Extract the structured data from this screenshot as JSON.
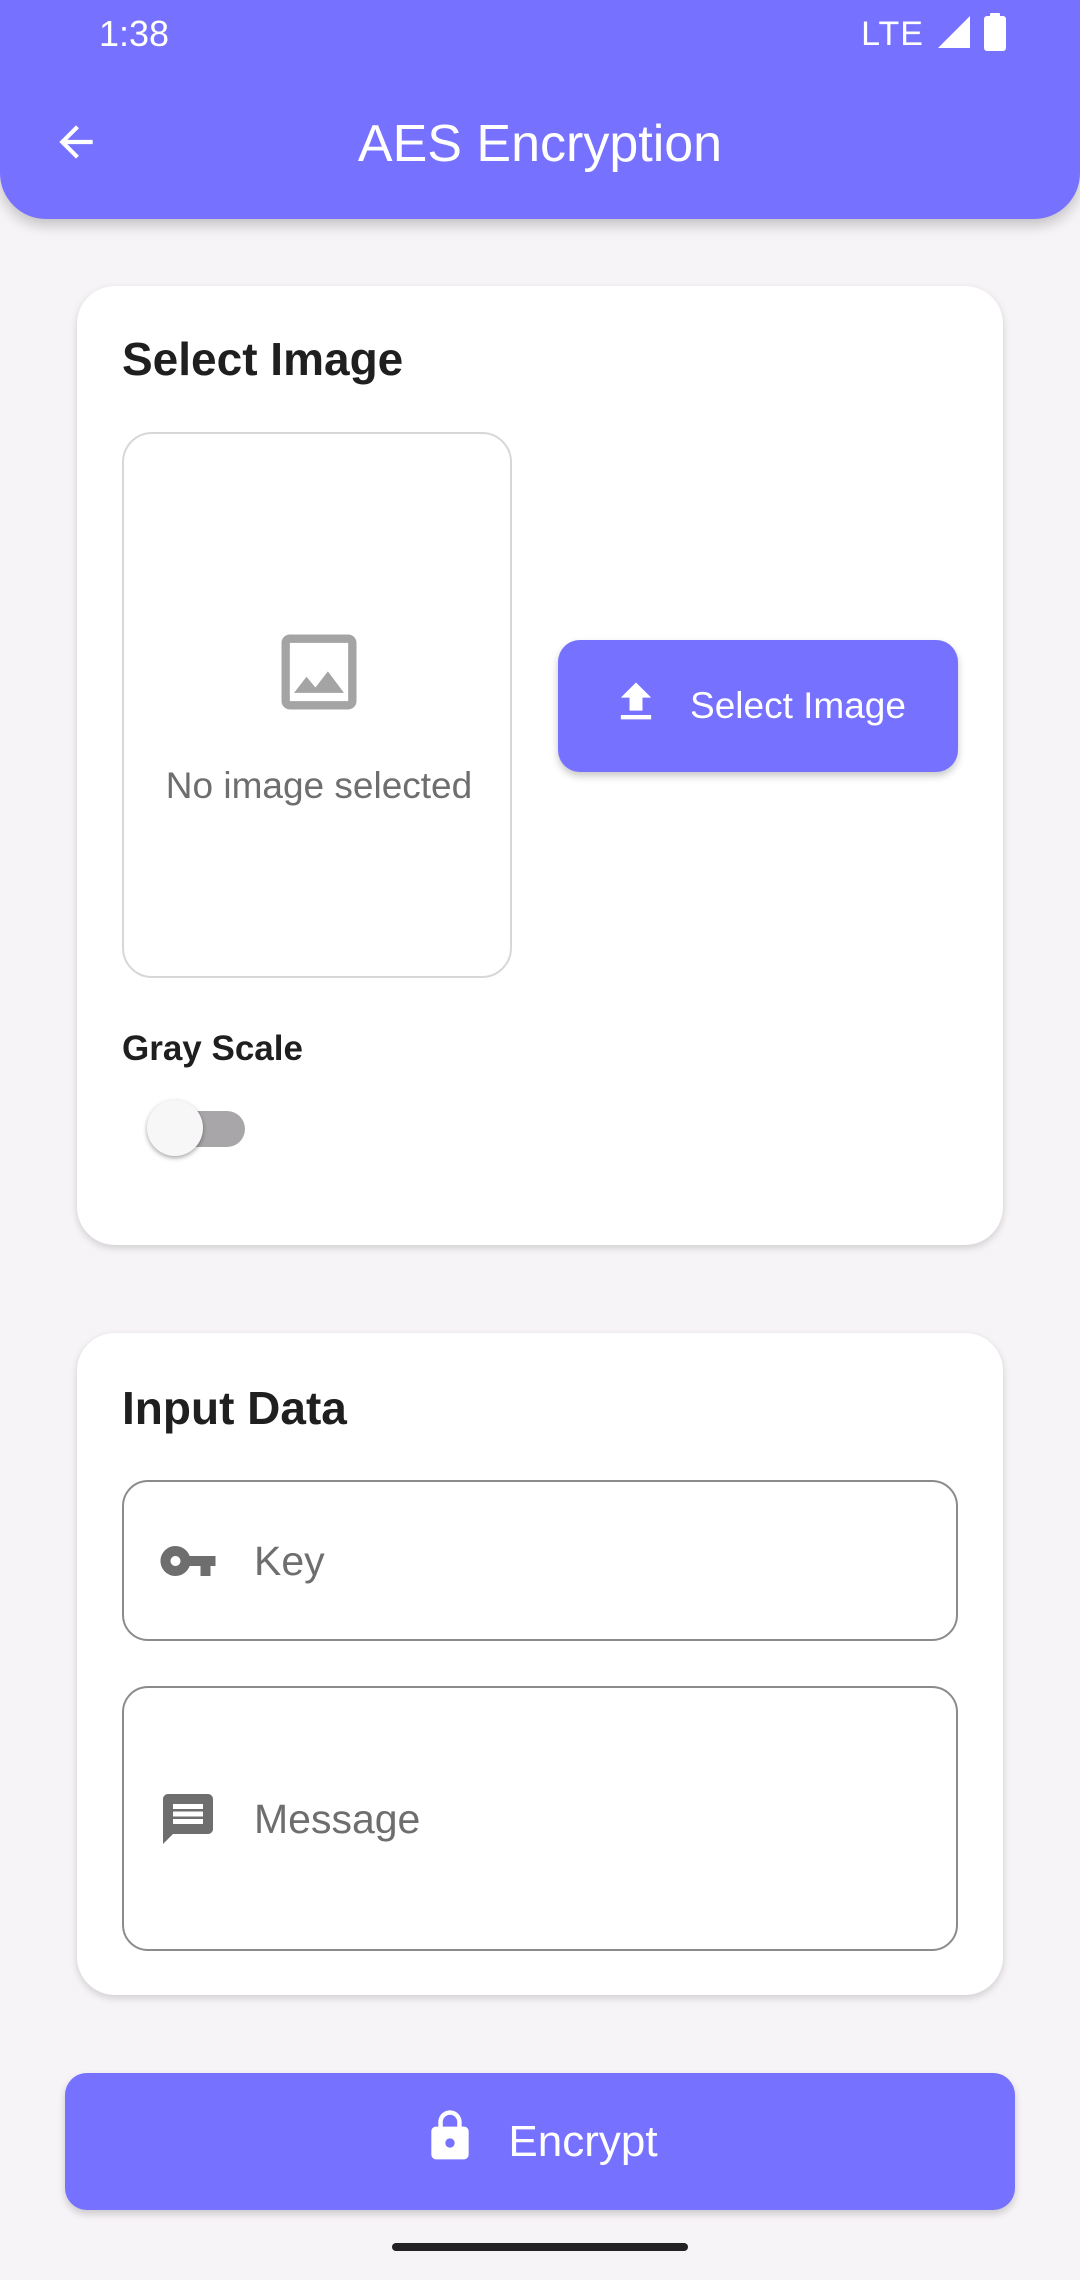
{
  "status_bar": {
    "time": "1:38",
    "network": "LTE",
    "icons": [
      "signal-icon",
      "battery-icon"
    ]
  },
  "app_bar": {
    "title": "AES Encryption",
    "back_icon": "arrow-back-icon",
    "color": "#7671ff"
  },
  "select_image_card": {
    "title": "Select Image",
    "placeholder_icon": "image-placeholder-icon",
    "no_image_text": "No image selected",
    "button_label": "Select Image",
    "button_icon": "upload-icon",
    "grayscale_label": "Gray Scale",
    "grayscale_enabled": false
  },
  "input_data_card": {
    "title": "Input Data",
    "key_placeholder": "Key",
    "key_value": "",
    "key_icon": "key-icon",
    "message_placeholder": "Message",
    "message_value": "",
    "message_icon": "message-icon"
  },
  "encrypt_button": {
    "label": "Encrypt",
    "icon": "lock-icon"
  },
  "colors": {
    "accent": "#7671ff",
    "background": "#f7f4f7",
    "card": "#ffffff"
  }
}
